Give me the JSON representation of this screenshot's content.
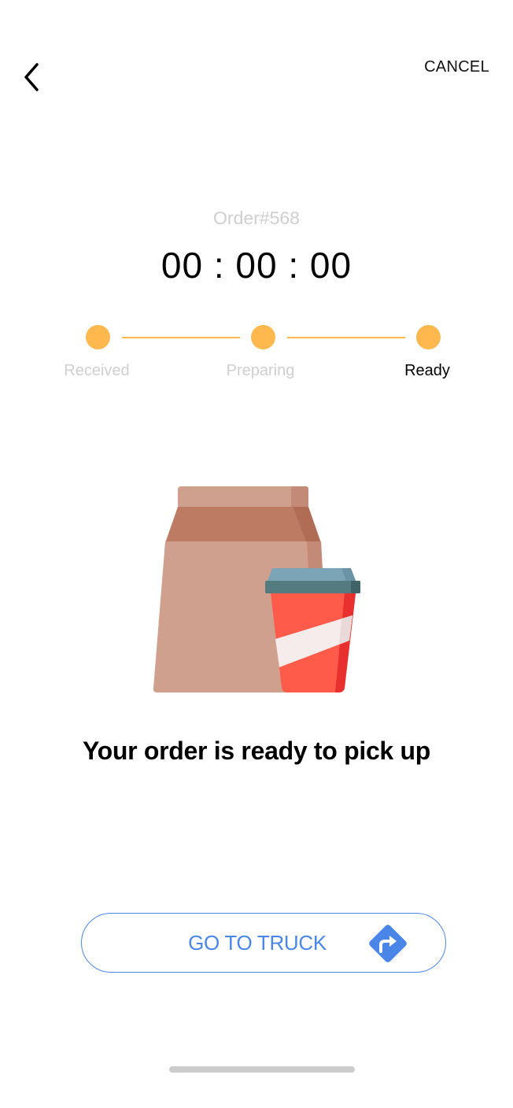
{
  "header": {
    "back_icon": "chevron-left-icon",
    "cancel_label": "CANCEL"
  },
  "order": {
    "number_label": "Order#568",
    "timer": "00 : 00 : 00"
  },
  "progress": {
    "steps": [
      {
        "label": "Received",
        "state": "done"
      },
      {
        "label": "Preparing",
        "state": "done"
      },
      {
        "label": "Ready",
        "state": "current"
      }
    ],
    "accent_color": "#ffb84d"
  },
  "illustration": {
    "icon": "takeaway-bag-and-cup-icon"
  },
  "message": "Your order is ready to pick up",
  "action": {
    "label": "GO TO TRUCK",
    "icon": "directions-icon",
    "color": "#4a86e8"
  }
}
